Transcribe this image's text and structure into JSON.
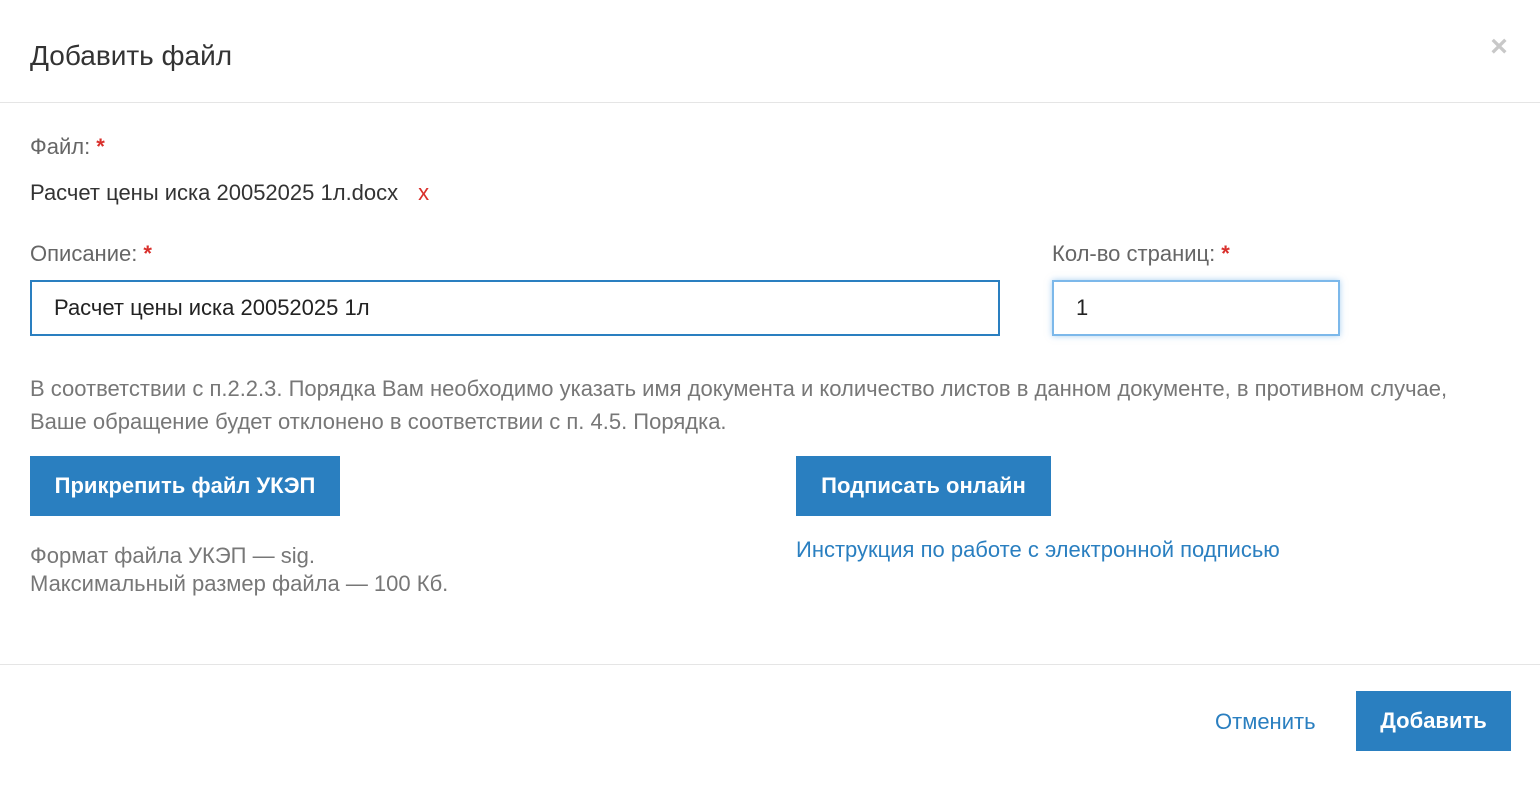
{
  "header": {
    "title": "Добавить файл",
    "close_glyph": "×"
  },
  "file": {
    "label": "Файл:",
    "required_mark": "*",
    "name": "Расчет цены иска 20052025 1л.docx",
    "remove_glyph": "x"
  },
  "description": {
    "label": "Описание:",
    "required_mark": "*",
    "value": "Расчет цены иска 20052025 1л"
  },
  "pages": {
    "label": "Кол-во страниц:",
    "required_mark": "*",
    "value": "1"
  },
  "hint": {
    "text": "В соответствии с п.2.2.3. Порядка Вам необходимо указать имя документа и количество листов в данном документе, в противном случае, Ваше обращение будет отклонено в соответствии с п. 4.5. Порядка."
  },
  "actions": {
    "attach_label": "Прикрепить файл УКЭП",
    "sign_label": "Подписать онлайн",
    "instruction_link": "Инструкция по работе с электронной подписью"
  },
  "format_info": {
    "line1": "Формат файла УКЭП — sig.",
    "line2": "Максимальный размер файла — 100 Кб."
  },
  "footer": {
    "cancel_label": "Отменить",
    "add_label": "Добавить"
  },
  "colors": {
    "accent": "#2a7fc0",
    "required": "#d9302c",
    "divider": "#e5e5e5"
  }
}
